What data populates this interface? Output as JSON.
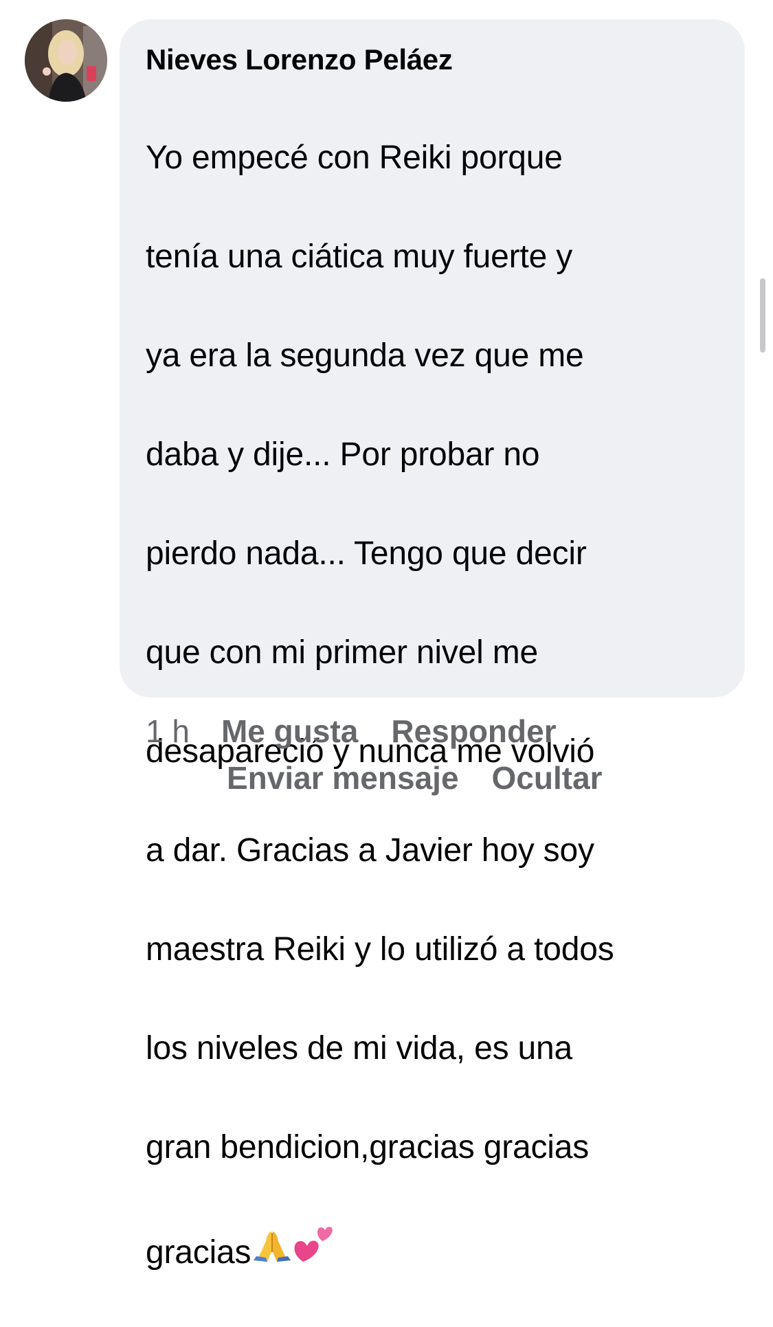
{
  "comment": {
    "author": "Nieves Lorenzo Peláez",
    "text_lines": [
      "Yo empecé con Reiki porque",
      "tenía una ciática muy fuerte y",
      "ya era la segunda vez que me",
      "daba y dije... Por probar no",
      "pierdo nada... Tengo que decir",
      "que con mi primer nivel me",
      "desapareció y nunca me volvió",
      "a dar. Gracias a Javier hoy soy",
      "maestra Reiki y lo utilizó a todos",
      "los niveles de mi vida, es una",
      "gran bendicion,gracias gracias"
    ],
    "last_line": "gracias",
    "emojis": [
      "folded-hands-icon",
      "two-hearts-icon"
    ]
  },
  "actions": {
    "timestamp": "1 h",
    "like": "Me gusta",
    "reply": "Responder",
    "send_message": "Enviar mensaje",
    "hide": "Ocultar"
  },
  "colors": {
    "bubble": "#eff0f4",
    "text": "#050505",
    "secondary": "#65676b"
  }
}
